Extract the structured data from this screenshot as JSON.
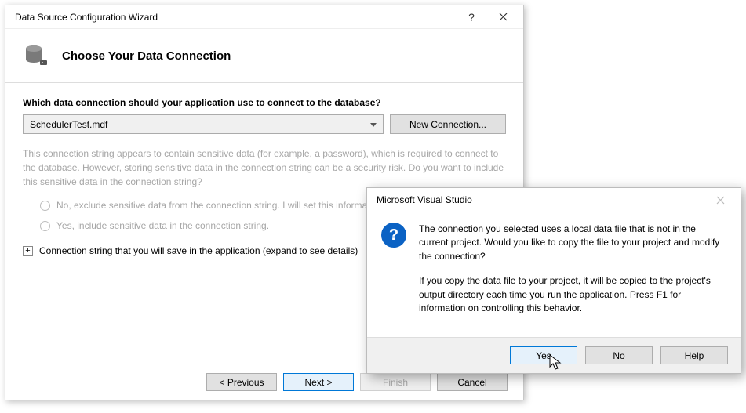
{
  "wizard": {
    "window_title": "Data Source Configuration Wizard",
    "header_title": "Choose Your Data Connection",
    "prompt": "Which data connection should your application use to connect to the database?",
    "selected_connection": "SchedulerTest.mdf",
    "new_connection_label": "New Connection...",
    "sensitive_hint": "This connection string appears to contain sensitive data (for example, a password), which is required to connect to the database. However, storing sensitive data in the connection string can be a security risk. Do you want to include this sensitive data in the connection string?",
    "radio_no": "No, exclude sensitive data from the connection string. I will set this information in my application code.",
    "radio_yes": "Yes, include sensitive data in the connection string.",
    "expand_label": "Connection string that you will save in the application (expand to see details)",
    "buttons": {
      "previous": "< Previous",
      "next": "Next >",
      "finish": "Finish",
      "cancel": "Cancel"
    }
  },
  "msgbox": {
    "title": "Microsoft Visual Studio",
    "para1": "The connection you selected uses a local data file that is not in the current project. Would you like to copy the file to your project and modify the connection?",
    "para2": "If you copy the data file to your project, it will be copied to the project's output directory each time you run the application. Press F1 for information on controlling this behavior.",
    "buttons": {
      "yes": "Yes",
      "no": "No",
      "help": "Help"
    }
  }
}
